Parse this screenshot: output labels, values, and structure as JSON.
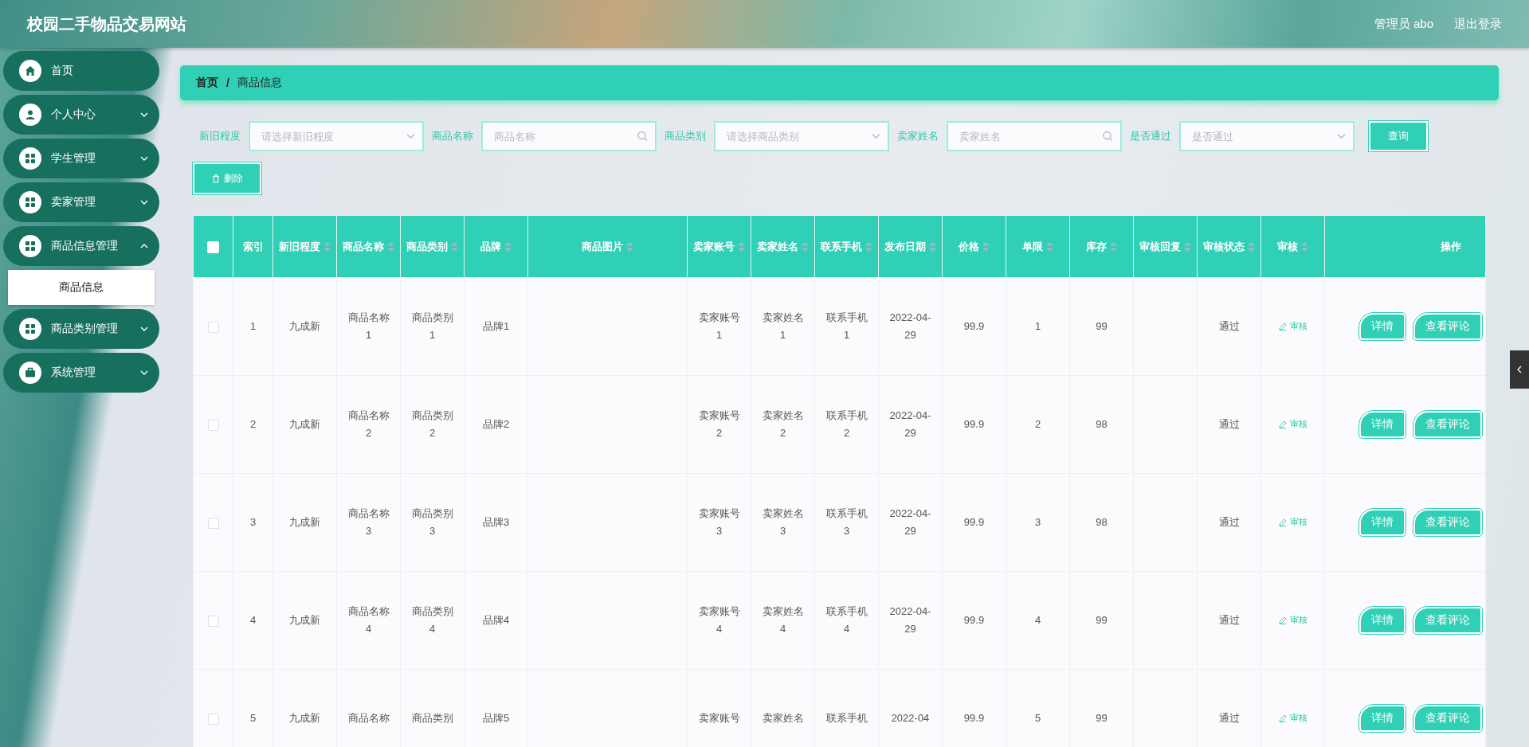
{
  "header": {
    "title": "校园二手物品交易网站",
    "user": "管理员 abo",
    "logout": "退出登录"
  },
  "sidebar": {
    "items": [
      {
        "label": "首页",
        "kind": "home",
        "expandable": false
      },
      {
        "label": "个人中心",
        "kind": "user",
        "expandable": true,
        "expanded": false
      },
      {
        "label": "学生管理",
        "kind": "grid",
        "expandable": true,
        "expanded": false
      },
      {
        "label": "卖家管理",
        "kind": "grid",
        "expandable": true,
        "expanded": false
      },
      {
        "label": "商品信息管理",
        "kind": "grid",
        "expandable": true,
        "expanded": true,
        "children": [
          {
            "label": "商品信息",
            "selected": true
          }
        ]
      },
      {
        "label": "商品类别管理",
        "kind": "grid",
        "expandable": true,
        "expanded": false
      },
      {
        "label": "系统管理",
        "kind": "briefcase",
        "expandable": true,
        "expanded": false
      }
    ]
  },
  "breadcrumb": {
    "items": [
      "首页",
      "商品信息"
    ],
    "separator": "/"
  },
  "filters": [
    {
      "label": "新旧程度",
      "kind": "select",
      "placeholder": "请选择新旧程度"
    },
    {
      "label": "商品名称",
      "kind": "search",
      "placeholder": "商品名称"
    },
    {
      "label": "商品类别",
      "kind": "select",
      "placeholder": "请选择商品类别"
    },
    {
      "label": "卖家姓名",
      "kind": "search",
      "placeholder": "卖家姓名"
    },
    {
      "label": "是否通过",
      "kind": "select",
      "placeholder": "是否通过"
    }
  ],
  "query_button": "查询",
  "delete_button": "删除",
  "table": {
    "header_checked": false,
    "columns": [
      {
        "label": "索引",
        "sortable": false
      },
      {
        "label": "新旧程度",
        "sortable": true
      },
      {
        "label": "商品名称",
        "sortable": true
      },
      {
        "label": "商品类别",
        "sortable": true
      },
      {
        "label": "品牌",
        "sortable": true
      },
      {
        "label": "商品图片",
        "sortable": true
      },
      {
        "label": "卖家账号",
        "sortable": true
      },
      {
        "label": "卖家姓名",
        "sortable": true
      },
      {
        "label": "联系手机",
        "sortable": true
      },
      {
        "label": "发布日期",
        "sortable": true
      },
      {
        "label": "价格",
        "sortable": true
      },
      {
        "label": "单限",
        "sortable": true
      },
      {
        "label": "库存",
        "sortable": true
      },
      {
        "label": "审核回复",
        "sortable": true
      },
      {
        "label": "审核状态",
        "sortable": true
      },
      {
        "label": "审核",
        "sortable": true
      },
      {
        "label": "操作",
        "sortable": false
      }
    ],
    "rows": [
      {
        "checked": false,
        "cells": [
          "1",
          "九成新",
          "商品名称1",
          "商品类别1",
          "品牌1",
          "",
          "卖家账号1",
          "卖家姓名1",
          "联系手机1",
          "2022-04-29",
          "99.9",
          "1",
          "99",
          "",
          "通过"
        ],
        "review": "审核",
        "actions": [
          "详情",
          "查看评论"
        ]
      },
      {
        "checked": false,
        "cells": [
          "2",
          "九成新",
          "商品名称2",
          "商品类别2",
          "品牌2",
          "",
          "卖家账号2",
          "卖家姓名2",
          "联系手机2",
          "2022-04-29",
          "99.9",
          "2",
          "98",
          "",
          "通过"
        ],
        "review": "审核",
        "actions": [
          "详情",
          "查看评论"
        ]
      },
      {
        "checked": false,
        "cells": [
          "3",
          "九成新",
          "商品名称3",
          "商品类别3",
          "品牌3",
          "",
          "卖家账号3",
          "卖家姓名3",
          "联系手机3",
          "2022-04-29",
          "99.9",
          "3",
          "98",
          "",
          "通过"
        ],
        "review": "审核",
        "actions": [
          "详情",
          "查看评论"
        ]
      },
      {
        "checked": false,
        "cells": [
          "4",
          "九成新",
          "商品名称4",
          "商品类别4",
          "品牌4",
          "",
          "卖家账号4",
          "卖家姓名4",
          "联系手机4",
          "2022-04-29",
          "99.9",
          "4",
          "99",
          "",
          "通过"
        ],
        "review": "审核",
        "actions": [
          "详情",
          "查看评论"
        ]
      },
      {
        "checked": false,
        "cells": [
          "5",
          "九成新",
          "商品名称",
          "商品类别",
          "品牌5",
          "",
          "卖家账号",
          "卖家姓名",
          "联系手机",
          "2022-04",
          "99.9",
          "5",
          "99",
          "",
          "通过"
        ],
        "review": "审核",
        "actions": [
          "详情",
          "查看评论"
        ]
      }
    ]
  }
}
